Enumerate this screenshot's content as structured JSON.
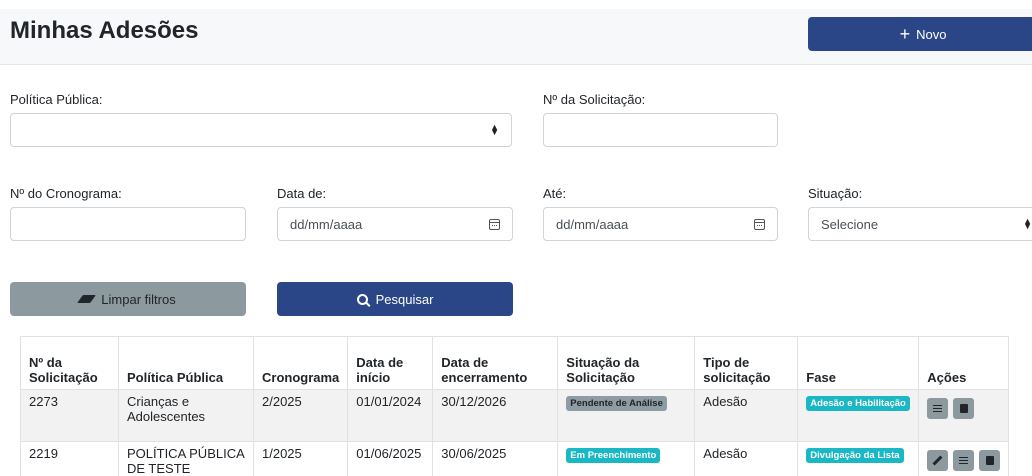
{
  "header": {
    "title": "Minhas Adesões",
    "new_button": "Novo"
  },
  "filters": {
    "politica_label": "Política Pública:",
    "politica_value": "",
    "solicitacao_label": "Nº da Solicitação:",
    "solicitacao_value": "",
    "cronograma_label": "Nº do Cronograma:",
    "cronograma_value": "",
    "data_de_label": "Data de:",
    "data_de_placeholder": "dd/mm/aaaa",
    "ate_label": "Até:",
    "ate_placeholder": "dd/mm/aaaa",
    "situacao_label": "Situação:",
    "situacao_value": "Selecione",
    "limpar_button": "Limpar filtros",
    "pesquisar_button": "Pesquisar"
  },
  "table": {
    "columns": [
      "Nº da Solicitação",
      "Política Pública",
      "Cronograma",
      "Data de início",
      "Data de encerramento",
      "Situação da Solicitação",
      "Tipo de solicitação",
      "Fase",
      "Ações"
    ],
    "rows": [
      {
        "numero": "2273",
        "politica": "Crianças e Adolescentes",
        "cronograma": "2/2025",
        "inicio": "01/01/2024",
        "encerramento": "30/12/2026",
        "situacao": "Pendente de Análise",
        "tipo": "Adesão",
        "fase": "Adesão e Habilitação"
      },
      {
        "numero": "2219",
        "politica": "POLÍTICA PÚBLICA DE TESTE",
        "cronograma": "1/2025",
        "inicio": "01/06/2025",
        "encerramento": "30/06/2025",
        "situacao": "Em Preenchimento",
        "tipo": "Adesão",
        "fase": "Divulgação da Lista"
      }
    ]
  },
  "icons": {
    "new": "plus-icon",
    "clear": "eraser-icon",
    "search": "search-icon",
    "select": "select-arrows-icon",
    "date": "calendar-icon",
    "list": "list-icon",
    "schedule": "calendar-icon",
    "edit": "pencil-icon"
  },
  "colors": {
    "primary": "#2a4687",
    "secondary": "#8c9aa0",
    "info": "#19b8c4",
    "badge_grey": "#8e9ca3"
  }
}
